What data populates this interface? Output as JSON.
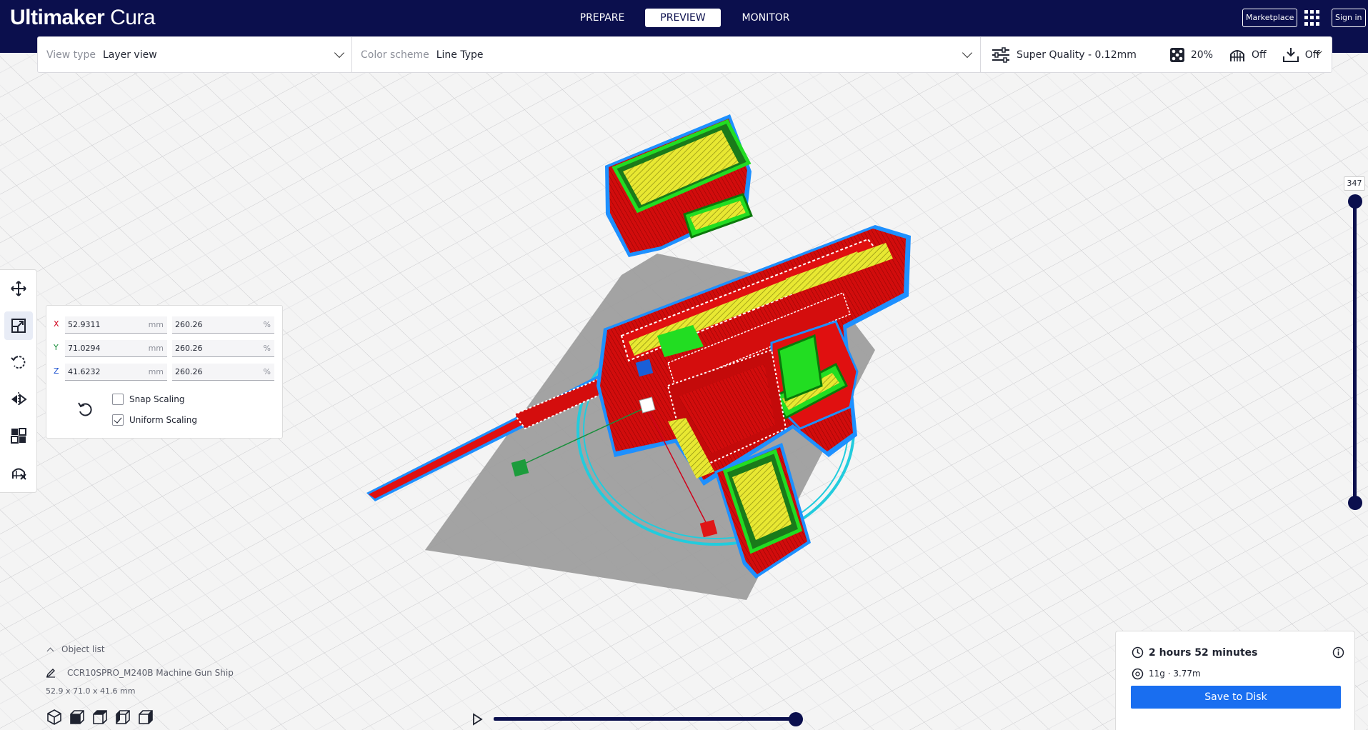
{
  "app": {
    "title_bold": "Ultimaker",
    "title_light": "Cura"
  },
  "stages": [
    {
      "label": "PREPARE",
      "active": false
    },
    {
      "label": "PREVIEW",
      "active": true
    },
    {
      "label": "MONITOR",
      "active": false
    }
  ],
  "header_buttons": {
    "marketplace": "Marketplace",
    "sign_in": "Sign in"
  },
  "toolbar": {
    "view_type_label": "View type",
    "view_type_value": "Layer view",
    "color_scheme_label": "Color scheme",
    "color_scheme_value": "Line Type",
    "profile": "Super Quality - 0.12mm",
    "infill": "20%",
    "support": "Off",
    "adhesion": "Off"
  },
  "scale_panel": {
    "x": {
      "label": "X",
      "mm": "52.9311",
      "percent": "260.26",
      "color": "#d0021b"
    },
    "y": {
      "label": "Y",
      "mm": "71.0294",
      "percent": "260.26",
      "color": "#1a8f3c"
    },
    "z": {
      "label": "Z",
      "mm": "41.6232",
      "percent": "260.26",
      "color": "#1a4fd0"
    },
    "unit_mm": "mm",
    "unit_percent": "%",
    "snap_scaling": {
      "label": "Snap Scaling",
      "checked": false
    },
    "uniform_scaling": {
      "label": "Uniform Scaling",
      "checked": true
    }
  },
  "tools": [
    "move-tool",
    "scale-tool",
    "rotate-tool",
    "mirror-tool",
    "per-model-settings-tool",
    "support-blocker-tool"
  ],
  "layer_slider": {
    "current_layer": "347",
    "upper_fraction": 1.0,
    "lower_fraction": 0.0
  },
  "object_list": {
    "header": "Object list",
    "object_name": "CCR10SPRO_M240B Machine Gun Ship",
    "dimensions": "52.9 x 71.0 x 41.6 mm"
  },
  "simulation": {
    "progress": 1.0
  },
  "print_info": {
    "time": "2 hours 52 minutes",
    "material": "11g · 3.77m",
    "save_button": "Save to Disk"
  },
  "colors": {
    "header_bg": "#0b0f4d",
    "accent_blue": "#196ef0",
    "wall_red": "#e01010",
    "skin_yellow": "#e8e832",
    "inner_green": "#22dd22",
    "outline_blue": "#1e90ff",
    "skirt_cyan": "#22ccdd"
  }
}
